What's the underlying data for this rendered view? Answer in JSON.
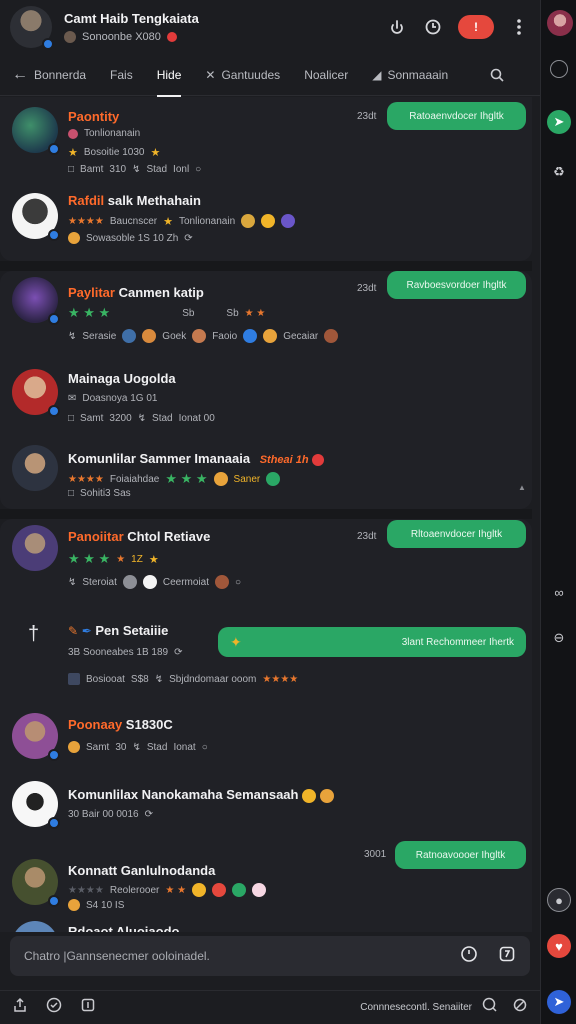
{
  "header": {
    "title": "Camt Haib Tengkaiata",
    "subtitle": "Sonoonbe X080",
    "live_label": "!"
  },
  "tabs": [
    {
      "label": "Bonnerda"
    },
    {
      "label": "Fais"
    },
    {
      "label": "Hide"
    },
    {
      "label": "Gantuudes"
    },
    {
      "label": "Noalicer"
    },
    {
      "label": "Sonmaaain"
    }
  ],
  "feed": {
    "g1": {
      "name": "Paontity",
      "line1": "Tonlionanain",
      "line2": "Bosoitie 1030",
      "line3a": "Bamt",
      "line3b": "310",
      "line3c": "Stad",
      "line3d": "Ionl",
      "time": "23dt",
      "pill": "Ratoaenvdocer Ihgltk"
    },
    "g2": {
      "name_accent": "Rafdil",
      "name_rest": " salk Methahain",
      "line1a": "Baucnscer",
      "line1b": "Tonlionanain",
      "line2": "Sowasoble 1S 10 Zh"
    },
    "g3": {
      "name_accent": "Paylitar",
      "name_rest": " Canmen katip",
      "time": "23dt",
      "pill": "Ravboesvordoer Ihgltk",
      "line2a": "Sb",
      "line2b": "Sb",
      "line3a": "Serasie",
      "line3b": "Goek",
      "line3c": "Faoio",
      "line3d": "Gecaiar"
    },
    "g4": {
      "name": "Mainaga Uogolda",
      "line1": "Doasnoya 1G 01",
      "line2a": "Samt",
      "line2b": "3200",
      "line2c": "Stad",
      "line2d": "Ionat 00"
    },
    "g5": {
      "name": "Komunlilar Sammer Imanaaia",
      "name_tail": "Stheai 1h",
      "line1": "Foiaiahdae",
      "line1b": "Saner",
      "line2": "Sohiti3 Sas"
    },
    "g6": {
      "name_accent": "Panoiitar",
      "name_rest": " Chtol Retiave",
      "time": "23dt",
      "pill": "Rltoaenvdocer Ihgltk",
      "line1": "1Z",
      "line2a": "Steroiat",
      "line2b": "Ceermoiat"
    },
    "g7": {
      "name": "Pen Setaiiie",
      "pill": "3lant Rechommeer Ihertk",
      "line1": "3B Sooneabes 1B 189",
      "line2a": "Bosiooat",
      "line2b": "S$8",
      "line2c": "Sbjdndomaar ooom"
    },
    "g8": {
      "name_accent": "Poonaay",
      "name_rest": " S1830C",
      "line1a": "Samt",
      "line1b": "30",
      "line1c": "Stad",
      "line1d": "Ionat"
    },
    "g9": {
      "name": "Komunlilax Nanokamaha Semansaah",
      "line1": "30 Bair 00 0016"
    },
    "g10": {
      "name": "Konnatt Ganlulnodanda",
      "time": "3001",
      "pill": "Ratnoavoooer Ihgltk",
      "line1": "Reolerooer",
      "line2": "S4 10 IS"
    },
    "g11": {
      "name": "Rdoaot Aluoiaodo"
    }
  },
  "composer": {
    "placeholder": "Chatro |Gannsenecmer ooloinadel."
  },
  "footer": {
    "text": "Connnesecontl. Senaiiter"
  },
  "colors": {
    "accent_green": "#2aa765",
    "accent_orange": "#ff6a2b",
    "live_red": "#e5483d",
    "verified_blue": "#2f7de1"
  }
}
